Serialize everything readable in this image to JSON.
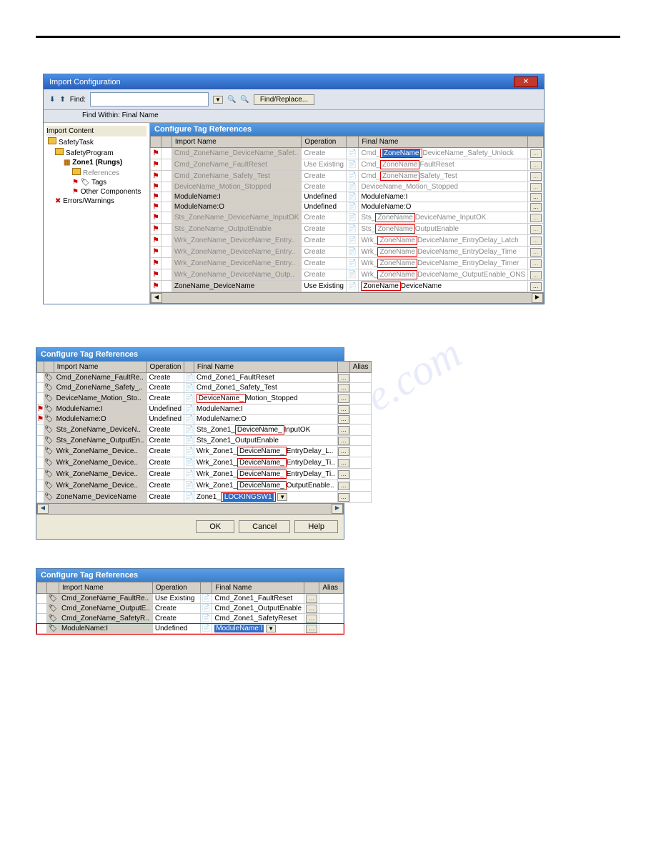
{
  "dialog1": {
    "title": "Import Configuration",
    "toolbar": {
      "find_label": "Find:",
      "find_replace_btn": "Find/Replace...",
      "find_within": "Find Within: Final Name"
    },
    "tree": {
      "header": "Import Content",
      "nodes": [
        "SafetyTask",
        "SafetyProgram",
        "Zone1 (Rungs)",
        "References",
        "Tags",
        "Other Components",
        "Errors/Warnings"
      ]
    },
    "panel_header": "Configure Tag References",
    "columns": [
      "Import Name",
      "Operation",
      "Final Name"
    ],
    "rows": [
      {
        "imp": "Cmd_ZoneName_DeviceName_Safet..",
        "op": "Create",
        "fn_pre": "Cmd_",
        "fn_box": "ZoneName",
        "fn_post": "DeviceName_Safety_Unlock",
        "sel": true,
        "grey": true
      },
      {
        "imp": "Cmd_ZoneName_FaultReset",
        "op": "Use Existing",
        "fn_pre": "Cmd_",
        "fn_box": "ZoneName",
        "fn_post": "FaultReset",
        "grey": true
      },
      {
        "imp": "Cmd_ZoneName_Safety_Test",
        "op": "Create",
        "fn_pre": "Cmd_",
        "fn_box": "ZoneName",
        "fn_post": "Safety_Test",
        "grey": true
      },
      {
        "imp": "DeviceName_Motion_Stopped",
        "op": "Create",
        "fn_pre": "DeviceName_Motion_Stopped",
        "grey": true
      },
      {
        "imp": "ModuleName:I",
        "op": "Undefined",
        "fn_pre": "ModuleName:I"
      },
      {
        "imp": "ModuleName:O",
        "op": "Undefined",
        "fn_pre": "ModuleName:O"
      },
      {
        "imp": "Sts_ZoneName_DeviceName_InputOK",
        "op": "Create",
        "fn_pre": "Sts_",
        "fn_box": "ZoneName",
        "fn_post": "DeviceName_InputOK",
        "grey": true
      },
      {
        "imp": "Sts_ZoneName_OutputEnable",
        "op": "Create",
        "fn_pre": "Sts_",
        "fn_box": "ZoneName",
        "fn_post": "OutputEnable",
        "grey": true
      },
      {
        "imp": "Wrk_ZoneName_DeviceName_Entry..",
        "op": "Create",
        "fn_pre": "Wrk_",
        "fn_box": "ZoneName",
        "fn_post": "DeviceName_EntryDelay_Latch",
        "grey": true
      },
      {
        "imp": "Wrk_ZoneName_DeviceName_Entry..",
        "op": "Create",
        "fn_pre": "Wrk_",
        "fn_box": "ZoneName",
        "fn_post": "DeviceName_EntryDelay_Time",
        "grey": true
      },
      {
        "imp": "Wrk_ZoneName_DeviceName_Entry..",
        "op": "Create",
        "fn_pre": "Wrk_",
        "fn_box": "ZoneName",
        "fn_post": "DeviceName_EntryDelay_Timer",
        "grey": true
      },
      {
        "imp": "Wrk_ZoneName_DeviceName_Outp..",
        "op": "Create",
        "fn_pre": "Wrk_",
        "fn_box": "ZoneName",
        "fn_post": "DeviceName_OutputEnable_ONS",
        "grey": true
      },
      {
        "imp": "ZoneName_DeviceName",
        "op": "Use Existing",
        "fn_pre": "",
        "fn_box": "ZoneName",
        "fn_post": "DeviceName"
      }
    ]
  },
  "dialog2": {
    "panel_header": "Configure Tag References",
    "columns": [
      "Import Name",
      "Operation",
      "Final Name",
      "Alias"
    ],
    "rows": [
      {
        "imp": "Cmd_ZoneName_FaultRe..",
        "op": "Create",
        "fn": "Cmd_Zone1_FaultReset"
      },
      {
        "imp": "Cmd_ZoneName_Safety_..",
        "op": "Create",
        "fn": "Cmd_Zone1_Safety_Test"
      },
      {
        "imp": "DeviceName_Motion_Sto..",
        "op": "Create",
        "fn_box": "DeviceName_",
        "fn_post": "Motion_Stopped"
      },
      {
        "imp": "ModuleName:I",
        "op": "Undefined",
        "fn": "ModuleName:I",
        "flag": true
      },
      {
        "imp": "ModuleName:O",
        "op": "Undefined",
        "fn": "ModuleName:O",
        "flag": true
      },
      {
        "imp": "Sts_ZoneName_DeviceN..",
        "op": "Create",
        "fn_pre": "Sts_Zone1_",
        "fn_box": "DeviceName_",
        "fn_post": "InputOK"
      },
      {
        "imp": "Sts_ZoneName_OutputEn..",
        "op": "Create",
        "fn": "Sts_Zone1_OutputEnable"
      },
      {
        "imp": "Wrk_ZoneName_Device..",
        "op": "Create",
        "fn_pre": "Wrk_Zone1_",
        "fn_box": "DeviceName_",
        "fn_post": "EntryDelay_L.."
      },
      {
        "imp": "Wrk_ZoneName_Device..",
        "op": "Create",
        "fn_pre": "Wrk_Zone1_",
        "fn_box": "DeviceName_",
        "fn_post": "EntryDelay_Ti.."
      },
      {
        "imp": "Wrk_ZoneName_Device..",
        "op": "Create",
        "fn_pre": "Wrk_Zone1_",
        "fn_box": "DeviceName_",
        "fn_post": "EntryDelay_Ti.."
      },
      {
        "imp": "Wrk_ZoneName_Device..",
        "op": "Create",
        "fn_pre": "Wrk_Zone1_",
        "fn_box": "DeviceName_",
        "fn_post": "OutputEnable.."
      },
      {
        "imp": "ZoneName_DeviceName",
        "op": "Create",
        "fn_pre": "Zone1_",
        "fn_sel": "LOCKINGSW1",
        "dd": true
      }
    ],
    "buttons": {
      "ok": "OK",
      "cancel": "Cancel",
      "help": "Help"
    }
  },
  "dialog3": {
    "panel_header": "Configure Tag References",
    "columns": [
      "Import Name",
      "Operation",
      "Final Name",
      "Alias"
    ],
    "rows": [
      {
        "imp": "Cmd_ZoneName_FaultRe..",
        "op": "Use Existing",
        "fn": "Cmd_Zone1_FaultReset"
      },
      {
        "imp": "Cmd_ZoneName_OutputE..",
        "op": "Create",
        "fn": "Cmd_Zone1_OutputEnable"
      },
      {
        "imp": "Cmd_ZoneName_SafetyR..",
        "op": "Create",
        "fn": "Cmd_Zone1_SafetyReset"
      },
      {
        "imp": "ModuleName:I",
        "op": "Undefined",
        "fn_sel": "ModuleName:I",
        "dd": true,
        "hl": true
      }
    ]
  }
}
